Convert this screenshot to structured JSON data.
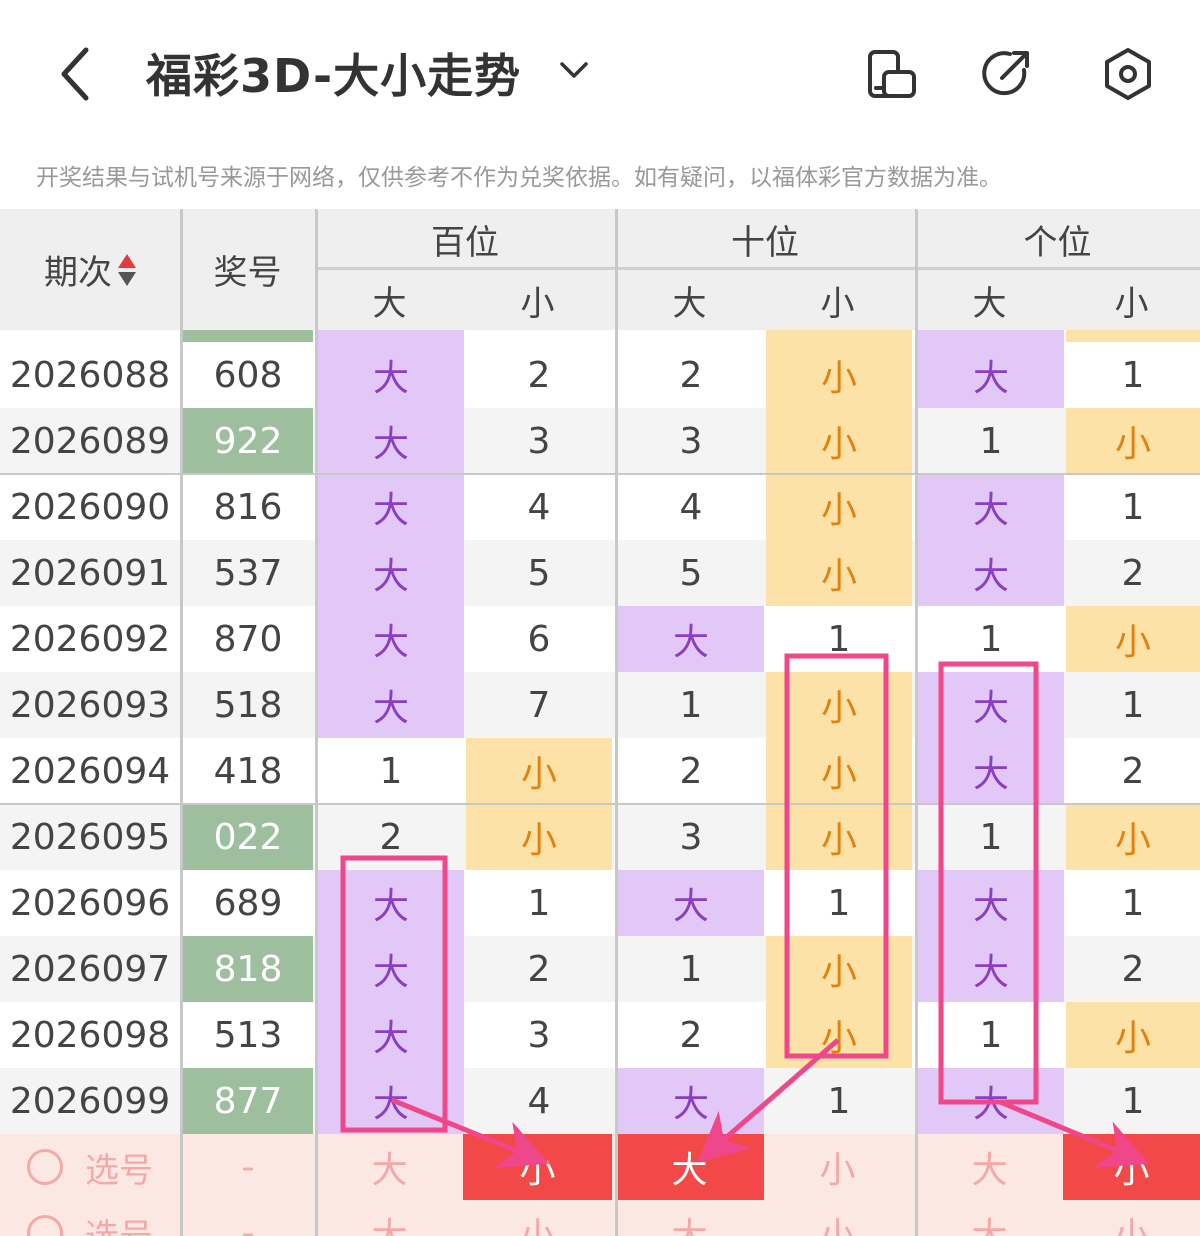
{
  "header": {
    "title": "福彩3D-大小走势",
    "back_icon": "chevron-left-icon",
    "dropdown_icon": "chevron-down-icon",
    "icons": [
      "phone-rotate-icon",
      "share-icon",
      "settings-hexagon-icon"
    ]
  },
  "notice": "开奖结果与试机号来源于网络，仅供参考不作为兑奖依据。如有疑问，以福体彩官方数据为准。",
  "table": {
    "col_period": "期次",
    "col_number": "奖号",
    "groups": [
      "百位",
      "十位",
      "个位"
    ],
    "sub": [
      "大",
      "小"
    ],
    "rows": [
      {
        "period": "2026088",
        "number": "608",
        "green": false,
        "cells": [
          {
            "v": "大",
            "t": "pur"
          },
          {
            "v": "2",
            "t": "n"
          },
          {
            "v": "2",
            "t": "n"
          },
          {
            "v": "小",
            "t": "org"
          },
          {
            "v": "大",
            "t": "pur"
          },
          {
            "v": "1",
            "t": "n"
          }
        ]
      },
      {
        "period": "2026089",
        "number": "922",
        "green": true,
        "cells": [
          {
            "v": "大",
            "t": "pur"
          },
          {
            "v": "3",
            "t": "n"
          },
          {
            "v": "3",
            "t": "n"
          },
          {
            "v": "小",
            "t": "org"
          },
          {
            "v": "1",
            "t": "n"
          },
          {
            "v": "小",
            "t": "org"
          }
        ]
      },
      {
        "period": "2026090",
        "number": "816",
        "green": false,
        "cells": [
          {
            "v": "大",
            "t": "pur"
          },
          {
            "v": "4",
            "t": "n"
          },
          {
            "v": "4",
            "t": "n"
          },
          {
            "v": "小",
            "t": "org"
          },
          {
            "v": "大",
            "t": "pur"
          },
          {
            "v": "1",
            "t": "n"
          }
        ]
      },
      {
        "period": "2026091",
        "number": "537",
        "green": false,
        "cells": [
          {
            "v": "大",
            "t": "pur"
          },
          {
            "v": "5",
            "t": "n"
          },
          {
            "v": "5",
            "t": "n"
          },
          {
            "v": "小",
            "t": "org"
          },
          {
            "v": "大",
            "t": "pur"
          },
          {
            "v": "2",
            "t": "n"
          }
        ]
      },
      {
        "period": "2026092",
        "number": "870",
        "green": false,
        "cells": [
          {
            "v": "大",
            "t": "pur"
          },
          {
            "v": "6",
            "t": "n"
          },
          {
            "v": "大",
            "t": "pur"
          },
          {
            "v": "1",
            "t": "n"
          },
          {
            "v": "1",
            "t": "n"
          },
          {
            "v": "小",
            "t": "org"
          }
        ]
      },
      {
        "period": "2026093",
        "number": "518",
        "green": false,
        "cells": [
          {
            "v": "大",
            "t": "pur"
          },
          {
            "v": "7",
            "t": "n"
          },
          {
            "v": "1",
            "t": "n"
          },
          {
            "v": "小",
            "t": "org"
          },
          {
            "v": "大",
            "t": "pur"
          },
          {
            "v": "1",
            "t": "n"
          }
        ]
      },
      {
        "period": "2026094",
        "number": "418",
        "green": false,
        "cells": [
          {
            "v": "1",
            "t": "n"
          },
          {
            "v": "小",
            "t": "org"
          },
          {
            "v": "2",
            "t": "n"
          },
          {
            "v": "小",
            "t": "org"
          },
          {
            "v": "大",
            "t": "pur"
          },
          {
            "v": "2",
            "t": "n"
          }
        ]
      },
      {
        "period": "2026095",
        "number": "022",
        "green": true,
        "cells": [
          {
            "v": "2",
            "t": "n"
          },
          {
            "v": "小",
            "t": "org"
          },
          {
            "v": "3",
            "t": "n"
          },
          {
            "v": "小",
            "t": "org"
          },
          {
            "v": "1",
            "t": "n"
          },
          {
            "v": "小",
            "t": "org"
          }
        ]
      },
      {
        "period": "2026096",
        "number": "689",
        "green": false,
        "cells": [
          {
            "v": "大",
            "t": "pur"
          },
          {
            "v": "1",
            "t": "n"
          },
          {
            "v": "大",
            "t": "pur"
          },
          {
            "v": "1",
            "t": "n"
          },
          {
            "v": "大",
            "t": "pur"
          },
          {
            "v": "1",
            "t": "n"
          }
        ]
      },
      {
        "period": "2026097",
        "number": "818",
        "green": true,
        "cells": [
          {
            "v": "大",
            "t": "pur"
          },
          {
            "v": "2",
            "t": "n"
          },
          {
            "v": "1",
            "t": "n"
          },
          {
            "v": "小",
            "t": "org"
          },
          {
            "v": "大",
            "t": "pur"
          },
          {
            "v": "2",
            "t": "n"
          }
        ]
      },
      {
        "period": "2026098",
        "number": "513",
        "green": false,
        "cells": [
          {
            "v": "大",
            "t": "pur"
          },
          {
            "v": "3",
            "t": "n"
          },
          {
            "v": "2",
            "t": "n"
          },
          {
            "v": "小",
            "t": "org"
          },
          {
            "v": "1",
            "t": "n"
          },
          {
            "v": "小",
            "t": "org"
          }
        ]
      },
      {
        "period": "2026099",
        "number": "877",
        "green": true,
        "cells": [
          {
            "v": "大",
            "t": "pur"
          },
          {
            "v": "4",
            "t": "n"
          },
          {
            "v": "大",
            "t": "pur"
          },
          {
            "v": "1",
            "t": "n"
          },
          {
            "v": "大",
            "t": "pur"
          },
          {
            "v": "1",
            "t": "n"
          }
        ]
      }
    ],
    "pick_rows": [
      {
        "label": "选号",
        "number": "-",
        "cells": [
          {
            "v": "大",
            "sel": false
          },
          {
            "v": "小",
            "sel": true
          },
          {
            "v": "大",
            "sel": true
          },
          {
            "v": "小",
            "sel": false
          },
          {
            "v": "大",
            "sel": false
          },
          {
            "v": "小",
            "sel": true
          }
        ]
      },
      {
        "label": "选号",
        "number": "-",
        "cells": [
          {
            "v": "大",
            "sel": false
          },
          {
            "v": "小",
            "sel": false
          },
          {
            "v": "大",
            "sel": false
          },
          {
            "v": "小",
            "sel": false
          },
          {
            "v": "大",
            "sel": false
          },
          {
            "v": "小",
            "sel": false
          }
        ]
      }
    ]
  },
  "colors": {
    "purple": "#e2c8f7",
    "orange": "#fde2a8",
    "green": "#9dbf9d",
    "red": "#f24848",
    "annotation": "#f0468a"
  }
}
